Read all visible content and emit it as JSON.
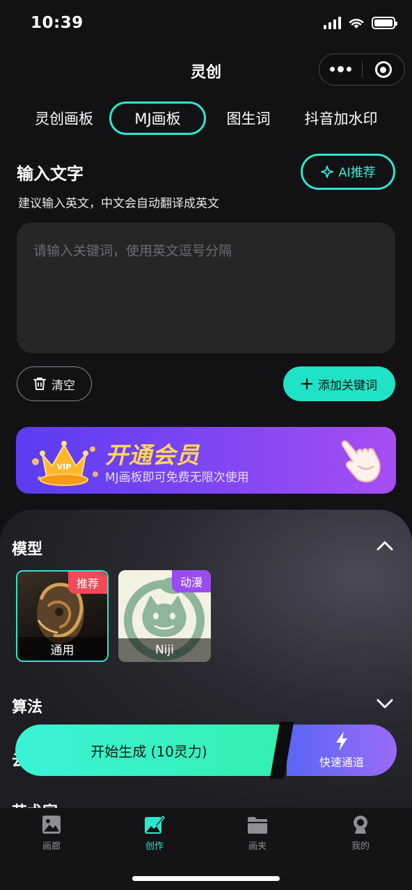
{
  "status_bar": {
    "time": "10:39"
  },
  "app": {
    "title": "灵创"
  },
  "tabs": [
    {
      "label": "灵创画板",
      "active": false
    },
    {
      "label": "MJ画板",
      "active": true
    },
    {
      "label": "图生词",
      "active": false
    },
    {
      "label": "抖音加水印",
      "active": false
    }
  ],
  "input_section": {
    "title": "输入文字",
    "subtitle": "建议输入英文，中文会自动翻译成英文",
    "ai_button": "AI推荐",
    "placeholder": "请输入关键词，使用英文逗号分隔",
    "value": "",
    "clear_button": "清空",
    "add_keyword_button": "添加关键词"
  },
  "vip_banner": {
    "title": "开通会员",
    "subtitle": "MJ画板即可免费无限次使用",
    "crown_text": "VIP"
  },
  "model_section": {
    "title": "模型",
    "models": [
      {
        "name": "通用",
        "badge": "推荐",
        "selected": true
      },
      {
        "name": "Niji",
        "badge": "动漫",
        "selected": false
      }
    ]
  },
  "algorithm_section": {
    "title": "算法"
  },
  "peek_titles": {
    "row3": "云",
    "row4": "艺术家"
  },
  "generate": {
    "main_label": "开始生成 (10灵力)",
    "fast_label": "快速通道"
  },
  "bottom_nav": [
    {
      "label": "画廊",
      "icon": "gallery-icon",
      "active": false
    },
    {
      "label": "创作",
      "icon": "create-icon",
      "active": true
    },
    {
      "label": "画夹",
      "icon": "folder-icon",
      "active": false
    },
    {
      "label": "我的",
      "icon": "profile-icon",
      "active": false
    }
  ],
  "colors": {
    "accent": "#2ee6cf",
    "background": "#121214",
    "vip_purple": "#7a45f3",
    "vip_gold": "#ffd65a",
    "badge_red": "#f04a5a",
    "badge_purple": "#9a4cf0"
  }
}
